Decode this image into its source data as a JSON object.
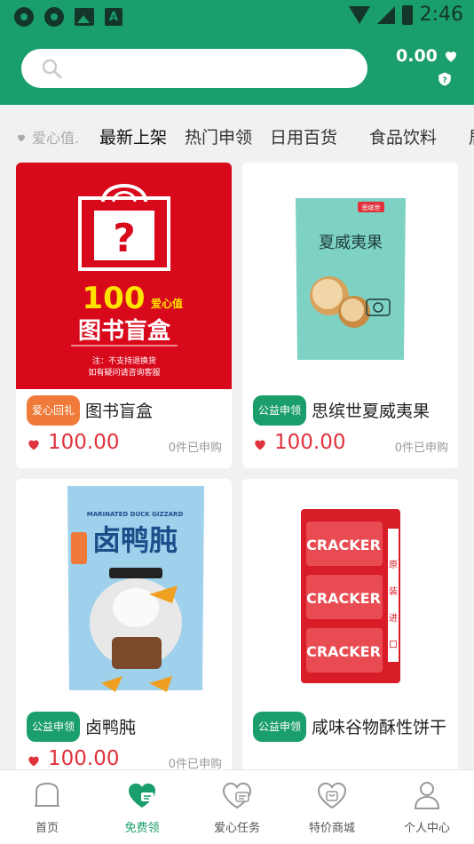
{
  "status_bar": {
    "time": "2:46"
  },
  "header": {
    "search": {
      "placeholder": ""
    },
    "balance": "0.00"
  },
  "tabs": {
    "love_label": "爱心值.",
    "items": [
      "最新上架",
      "热门申领",
      "日用百货",
      "食品饮料",
      "居"
    ]
  },
  "products": [
    {
      "badge": "爱心回礼",
      "badge_color": "#f07a39",
      "title": "图书盲盒",
      "price": "100.00",
      "applied": "0件已申购",
      "image_text": {
        "number": "100",
        "unit": "爱心值",
        "name": "图书盲盒",
        "note1": "注：不支持退换货",
        "note2": "如有疑问请咨询客服"
      }
    },
    {
      "badge": "公益申领",
      "badge_color": "#1a9e6b",
      "title": "思缤世夏威夷果",
      "price": "100.00",
      "applied": "0件已申购",
      "image_text": {
        "brand": "思缤世",
        "name": "夏威夷果"
      }
    },
    {
      "badge": "公益申领",
      "badge_color": "#1a9e6b",
      "title": "卤鸭肫",
      "price": "100.00",
      "applied": "0件已申购",
      "image_text": {
        "top": "MARINATED DUCK GIZZARD",
        "name": "卤鸭肫"
      }
    },
    {
      "badge": "公益申领",
      "badge_color": "#1a9e6b",
      "title": "咸味谷物酥性饼干",
      "price": "",
      "applied": "",
      "image_text": {
        "brand": "CRACKER",
        "side": "原装进口"
      }
    }
  ],
  "bottom_nav": [
    {
      "label": "首页",
      "icon": "home-icon"
    },
    {
      "label": "免费领",
      "icon": "free-gift-icon"
    },
    {
      "label": "爱心任务",
      "icon": "love-task-icon"
    },
    {
      "label": "特价商城",
      "icon": "mall-icon"
    },
    {
      "label": "个人中心",
      "icon": "user-icon"
    }
  ],
  "colors": {
    "brand": "#1a9e6b",
    "price": "#e0323c",
    "badge_orange": "#f07a39"
  }
}
